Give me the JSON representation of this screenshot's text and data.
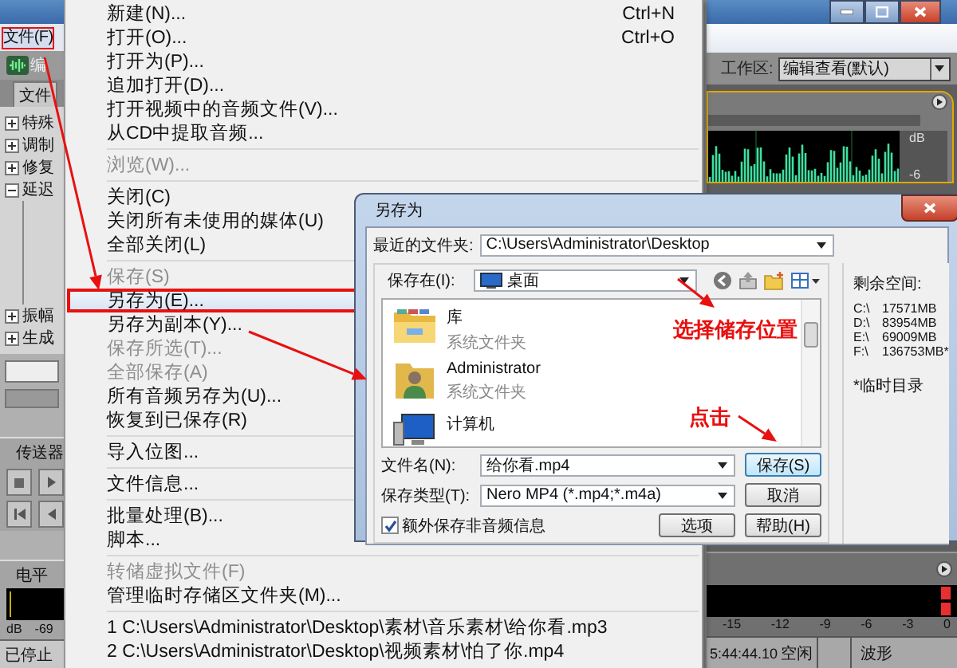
{
  "app": {
    "menubar": [
      {
        "label": "文件(F)",
        "selected": true,
        "marked": true
      }
    ],
    "toolbar_label": "编",
    "panel_tab": "文件",
    "tree": [
      {
        "label": "特殊",
        "expanded": false
      },
      {
        "label": "调制",
        "expanded": false
      },
      {
        "label": "修复",
        "expanded": false
      },
      {
        "label": "延迟",
        "expanded": true
      },
      {
        "label": "振幅",
        "expanded": false
      },
      {
        "label": "生成",
        "expanded": false
      }
    ],
    "transport_title": "传送器",
    "level_title": "电平",
    "level_scale": [
      "dB",
      "-69"
    ],
    "status": "已停止",
    "workspace_label": "工作区:",
    "workspace_value": "编辑查看(默认)",
    "waveform_scale": [
      "dB",
      "-6"
    ],
    "meter_scale": [
      "-15",
      "-12",
      "-9",
      "-6",
      "-3",
      "0"
    ],
    "time": "5:44:44.10",
    "state": "空闲",
    "view": "波形"
  },
  "file_menu": {
    "groups": [
      [
        {
          "label": "新建(N)...",
          "shortcut": "Ctrl+N",
          "disabled": false,
          "selected": false,
          "marked": false
        },
        {
          "label": "打开(O)...",
          "shortcut": "Ctrl+O",
          "disabled": false,
          "selected": false,
          "marked": false
        },
        {
          "label": "打开为(P)...",
          "disabled": false,
          "selected": false,
          "marked": false
        },
        {
          "label": "追加打开(D)...",
          "disabled": false,
          "selected": false,
          "marked": false
        },
        {
          "label": "打开视频中的音频文件(V)...",
          "disabled": false,
          "selected": false,
          "marked": false
        },
        {
          "label": "从CD中提取音频...",
          "disabled": false,
          "selected": false,
          "marked": false
        }
      ],
      [
        {
          "label": "浏览(W)...",
          "disabled": true,
          "selected": false,
          "marked": false
        }
      ],
      [
        {
          "label": "关闭(C)",
          "disabled": false,
          "selected": false,
          "marked": false
        },
        {
          "label": "关闭所有未使用的媒体(U)",
          "disabled": false,
          "selected": false,
          "marked": false
        },
        {
          "label": "全部关闭(L)",
          "disabled": false,
          "selected": false,
          "marked": false
        }
      ],
      [
        {
          "label": "保存(S)",
          "disabled": true,
          "selected": false,
          "marked": false
        },
        {
          "label": "另存为(E)...",
          "disabled": false,
          "selected": true,
          "marked": true
        },
        {
          "label": "另存为副本(Y)...",
          "disabled": false,
          "selected": false,
          "marked": false
        },
        {
          "label": "保存所选(T)...",
          "disabled": true,
          "selected": false,
          "marked": false
        },
        {
          "label": "全部保存(A)",
          "disabled": true,
          "selected": false,
          "marked": false
        },
        {
          "label": "所有音频另存为(U)...",
          "disabled": false,
          "selected": false,
          "marked": false
        },
        {
          "label": "恢复到已保存(R)",
          "disabled": false,
          "selected": false,
          "marked": false
        }
      ],
      [
        {
          "label": "导入位图...",
          "disabled": false,
          "selected": false,
          "marked": false
        }
      ],
      [
        {
          "label": "文件信息...",
          "disabled": false,
          "selected": false,
          "marked": false
        }
      ],
      [
        {
          "label": "批量处理(B)...",
          "disabled": false,
          "selected": false,
          "marked": false
        },
        {
          "label": "脚本...",
          "disabled": false,
          "selected": false,
          "marked": false
        }
      ],
      [
        {
          "label": "转储虚拟文件(F)",
          "disabled": true,
          "selected": false,
          "marked": false
        },
        {
          "label": "管理临时存储区文件夹(M)...",
          "disabled": false,
          "selected": false,
          "marked": false
        }
      ],
      [
        {
          "label": "1 C:\\Users\\Administrator\\Desktop\\素材\\音乐素材\\给你看.mp3",
          "disabled": false,
          "selected": false,
          "marked": false
        },
        {
          "label": "2 C:\\Users\\Administrator\\Desktop\\视频素材\\怕了你.mp4",
          "disabled": false,
          "selected": false,
          "marked": false
        }
      ]
    ]
  },
  "dialog": {
    "title": "另存为",
    "recent_label": "最近的文件夹:",
    "recent_path": "C:\\Users\\Administrator\\Desktop",
    "save_in_label": "保存在(I):",
    "save_in_value": "桌面",
    "items": [
      {
        "kind": "library",
        "name": "库",
        "type": "系统文件夹"
      },
      {
        "kind": "user",
        "name": "Administrator",
        "type": "系统文件夹"
      },
      {
        "kind": "computer",
        "name": "计算机"
      }
    ],
    "filename_label": "文件名(N):",
    "filename": "给你看.mp4",
    "filetype_label": "保存类型(T):",
    "filetype": "Nero MP4 (*.mp4;*.m4a)",
    "extra": {
      "label": "额外保存非音频信息",
      "checked": true
    },
    "buttons": [
      {
        "kind": "save",
        "label": "保存(S)",
        "default": true
      },
      {
        "kind": "cancel",
        "label": "取消",
        "default": false
      },
      {
        "kind": "options",
        "label": "选项",
        "default": false
      },
      {
        "kind": "help",
        "label": "帮助(H)",
        "default": false
      }
    ],
    "free_title": "剩余空间:",
    "drives": [
      {
        "drive": "C:\\",
        "size": "17571MB"
      },
      {
        "drive": "D:\\",
        "size": "83954MB"
      },
      {
        "drive": "E:\\",
        "size": "69009MB"
      },
      {
        "drive": "F:\\",
        "size": "136753MB*"
      }
    ],
    "note": "*临时目录"
  },
  "annotations": [
    {
      "kind": "note",
      "text": "选择储存位置"
    },
    {
      "kind": "note",
      "text": "点击"
    }
  ]
}
